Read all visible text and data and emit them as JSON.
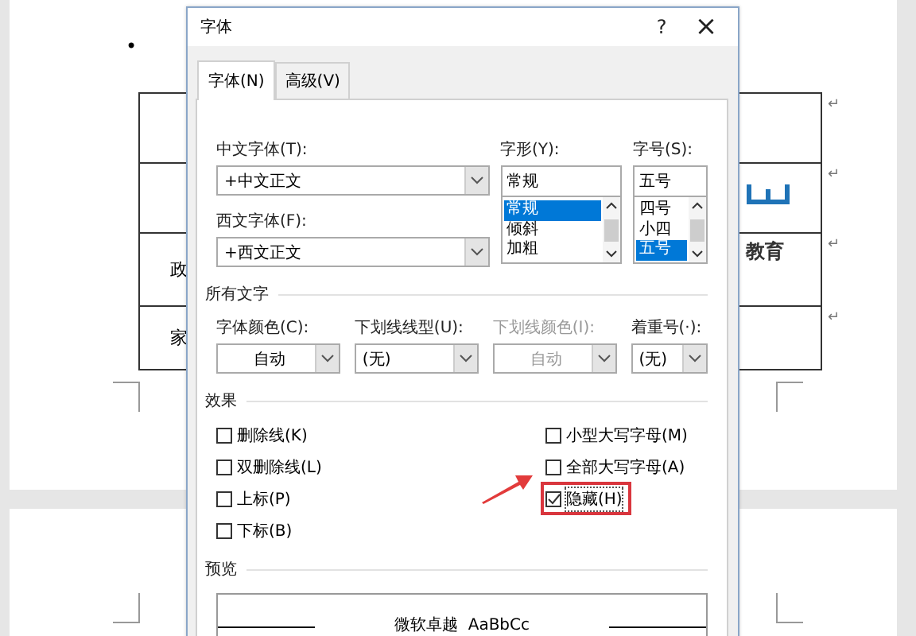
{
  "document": {
    "bullet": "•",
    "table_rows": [
      {
        "left_text": "",
        "end_mark": "↵"
      },
      {
        "left_text": "",
        "end_mark": "↵"
      },
      {
        "left_text": "政",
        "end_mark": "↵"
      },
      {
        "left_text": "家",
        "end_mark": "↵"
      }
    ],
    "logo_text": "教育"
  },
  "dialog": {
    "title": "字体",
    "help": "?",
    "close": "×",
    "tabs": [
      {
        "label": "字体(N)",
        "selected": true
      },
      {
        "label": "高级(V)",
        "selected": false
      }
    ],
    "east_asian_font": {
      "label": "中文字体(T):",
      "value": "+中文正文"
    },
    "latin_font": {
      "label": "西文字体(F):",
      "value": "+西文正文"
    },
    "style": {
      "label": "字形(Y):",
      "value": "常规",
      "options": [
        {
          "label": "常规",
          "selected": true
        },
        {
          "label": "倾斜",
          "selected": false
        },
        {
          "label": "加粗",
          "selected": false
        }
      ]
    },
    "size": {
      "label": "字号(S):",
      "value": "五号",
      "options": [
        {
          "label": "四号",
          "selected": false
        },
        {
          "label": "小四",
          "selected": false
        },
        {
          "label": "五号",
          "selected": true
        }
      ]
    },
    "all_text_heading": "所有文字",
    "dropdowns": [
      {
        "label": "字体颜色(C):",
        "value": "自动",
        "disabled": false,
        "centered": true
      },
      {
        "label": "下划线线型(U):",
        "value": "(无)",
        "disabled": false,
        "centered": false
      },
      {
        "label": "下划线颜色(I):",
        "value": "自动",
        "disabled": true,
        "centered": true
      },
      {
        "label": "着重号(·):",
        "value": "(无)",
        "disabled": false,
        "centered": false
      }
    ],
    "effects_heading": "效果",
    "effects_left": [
      {
        "label": "删除线(K)",
        "checked": false
      },
      {
        "label": "双删除线(L)",
        "checked": false
      },
      {
        "label": "上标(P)",
        "checked": false
      },
      {
        "label": "下标(B)",
        "checked": false
      }
    ],
    "effects_right": [
      {
        "label": "小型大写字母(M)",
        "checked": false
      },
      {
        "label": "全部大写字母(A)",
        "checked": false
      },
      {
        "label": "隐藏(H)",
        "checked": true
      }
    ],
    "preview_heading": "预览",
    "preview_text": "微软卓越  AaBbCc"
  }
}
